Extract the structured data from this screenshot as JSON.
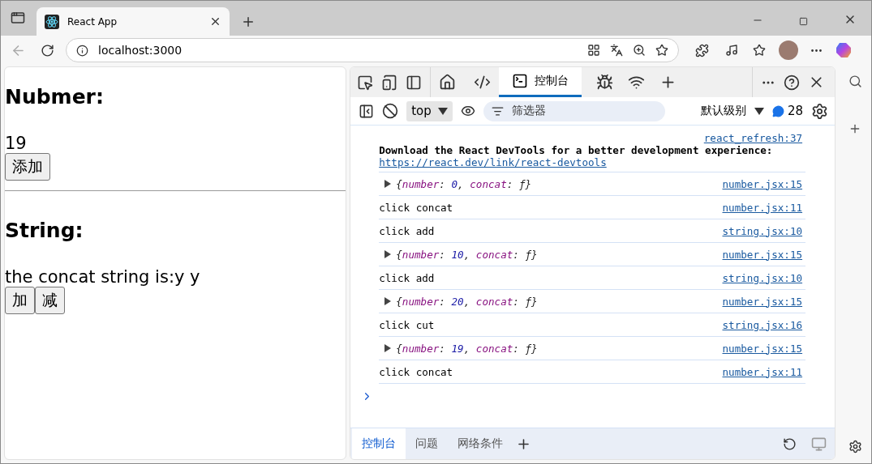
{
  "browser": {
    "tab_title": "React App",
    "address": "localhost:3000"
  },
  "page": {
    "sections": [
      {
        "heading": "Nubmer:",
        "text": "19",
        "buttons": [
          "添加"
        ]
      },
      {
        "heading": "String:",
        "text": "the concat string is:y y",
        "buttons": [
          "加",
          "减"
        ]
      }
    ]
  },
  "devtools": {
    "tabs": [
      {
        "label": "控制台",
        "selected": true
      }
    ],
    "context": "top",
    "filter_placeholder": "筛选器",
    "level": "默认级别",
    "message_count": "28",
    "console": [
      {
        "kind": "notice",
        "source": "react_refresh:37",
        "text": "Download the React DevTools for a better development experience:",
        "link": "https://react.dev/link/react-devtools"
      },
      {
        "kind": "object",
        "source": "number.jsx:15",
        "parts": [
          {
            "text": "{"
          },
          {
            "text": "number",
            "color": "#881280"
          },
          {
            "text": ": "
          },
          {
            "text": "0",
            "color": "#1a1aa6"
          },
          {
            "text": ", "
          },
          {
            "text": "concat",
            "color": "#881280"
          },
          {
            "text": ": ƒ}"
          }
        ]
      },
      {
        "kind": "log",
        "source": "number.jsx:11",
        "text": "click concat"
      },
      {
        "kind": "log",
        "source": "string.jsx:10",
        "text": "click add"
      },
      {
        "kind": "object",
        "source": "number.jsx:15",
        "parts": [
          {
            "text": "{"
          },
          {
            "text": "number",
            "color": "#881280"
          },
          {
            "text": ": "
          },
          {
            "text": "10",
            "color": "#1a1aa6"
          },
          {
            "text": ", "
          },
          {
            "text": "concat",
            "color": "#881280"
          },
          {
            "text": ": ƒ}"
          }
        ]
      },
      {
        "kind": "log",
        "source": "string.jsx:10",
        "text": "click add"
      },
      {
        "kind": "object",
        "source": "number.jsx:15",
        "parts": [
          {
            "text": "{"
          },
          {
            "text": "number",
            "color": "#881280"
          },
          {
            "text": ": "
          },
          {
            "text": "20",
            "color": "#1a1aa6"
          },
          {
            "text": ", "
          },
          {
            "text": "concat",
            "color": "#881280"
          },
          {
            "text": ": ƒ}"
          }
        ]
      },
      {
        "kind": "log",
        "source": "string.jsx:16",
        "text": "click cut"
      },
      {
        "kind": "object",
        "source": "number.jsx:15",
        "parts": [
          {
            "text": "{"
          },
          {
            "text": "number",
            "color": "#881280"
          },
          {
            "text": ": "
          },
          {
            "text": "19",
            "color": "#1a1aa6"
          },
          {
            "text": ", "
          },
          {
            "text": "concat",
            "color": "#881280"
          },
          {
            "text": ": ƒ}"
          }
        ]
      },
      {
        "kind": "log",
        "source": "number.jsx:11",
        "text": "click concat"
      }
    ],
    "drawer_tabs": [
      {
        "label": "控制台",
        "selected": true
      },
      {
        "label": "问题",
        "selected": false
      },
      {
        "label": "网络条件",
        "selected": false
      }
    ]
  }
}
